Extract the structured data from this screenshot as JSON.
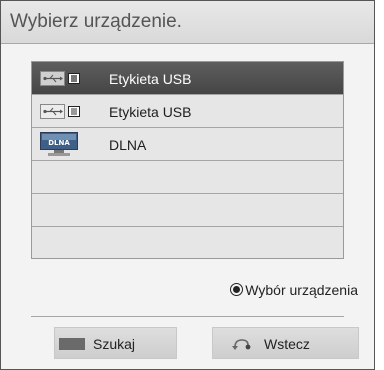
{
  "dialog": {
    "title": "Wybierz urządzenie."
  },
  "devices": [
    {
      "label": "Etykieta USB",
      "icon": "usb-drive-icon",
      "selected": true
    },
    {
      "label": "Etykieta USB",
      "icon": "usb-drive-icon",
      "selected": false
    },
    {
      "label": "DLNA",
      "icon": "dlna-server-icon",
      "selected": false
    }
  ],
  "hint": {
    "text": "Wybór urządzenia"
  },
  "footer": {
    "search_label": "Szukaj",
    "back_label": "Wstecz"
  },
  "colors": {
    "selected_row": "#525252",
    "list_bg": "#e6e6e6",
    "dialog_bg": "#f3f3f3"
  }
}
